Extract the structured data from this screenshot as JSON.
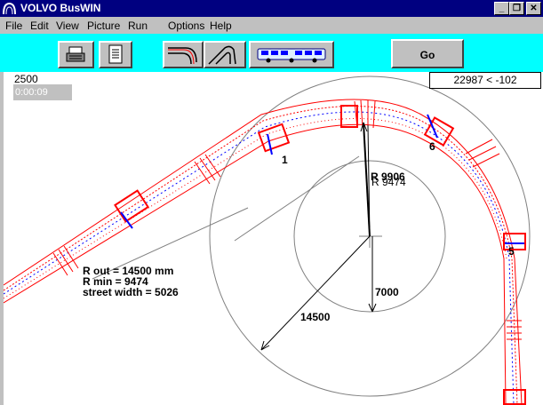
{
  "window": {
    "title": "VOLVO  BusWIN",
    "controls": [
      "_",
      "❐",
      "✕"
    ]
  },
  "menu": {
    "items": [
      "File",
      "Edit",
      "View",
      "Picture",
      "Run",
      "Options",
      "Help"
    ]
  },
  "toolbar": {
    "print_icon": "printer-icon",
    "document_icon": "document-icon",
    "corner_turn_icon": "corner-turn-icon",
    "curve_turn_icon": "curve-turn-icon",
    "bus_icon": "bus-icon",
    "go_label": "Go",
    "accent_color": "#00ffff"
  },
  "canvas": {
    "step_value": "2500",
    "timer": "0:00:09",
    "coords": "22987 < -102",
    "info": {
      "r_out": "R out =   14500 mm",
      "r_min": "R min = 9474",
      "street_width": "street width  = 5026"
    },
    "dimensions": {
      "r_9906": "R 9906",
      "r_9474": "R 9474",
      "d_7000": "7000",
      "d_14500": "14500"
    },
    "markers": [
      "1",
      "6",
      "5"
    ],
    "colors": {
      "bus_outline": "#ff0000",
      "axle": "#0000ff",
      "guide": "#808080"
    }
  }
}
